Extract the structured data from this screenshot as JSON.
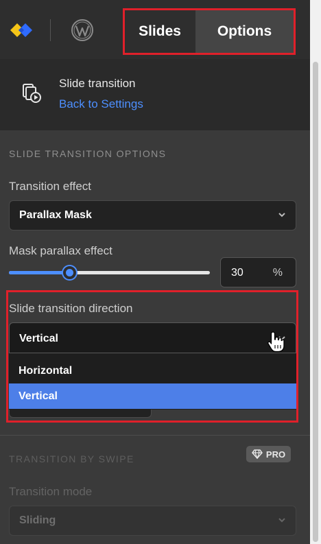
{
  "topbar": {
    "tabs": [
      "Slides",
      "Options"
    ]
  },
  "header": {
    "title": "Slide transition",
    "back_link": "Back to Settings"
  },
  "options": {
    "section_title": "SLIDE TRANSITION OPTIONS",
    "transition_effect_label": "Transition effect",
    "transition_effect_value": "Parallax Mask",
    "mask_parallax_label": "Mask parallax effect",
    "mask_parallax_value": "30",
    "mask_parallax_unit": "%",
    "mask_parallax_fraction": 0.3,
    "direction_label": "Slide transition direction",
    "direction_value": "Vertical",
    "direction_options": [
      "Horizontal",
      "Vertical"
    ]
  },
  "swipe": {
    "section_title": "TRANSITION BY SWIPE",
    "pro_badge": "PRO",
    "mode_label": "Transition mode",
    "mode_value": "Sliding"
  },
  "colors": {
    "accent": "#4d8fff",
    "highlight": "#e0202a",
    "selected_option": "#4d7fe8"
  },
  "icons": [
    "app-logo-icon",
    "wordpress-icon",
    "slide-transition-icon",
    "chevron-down-icon",
    "hand-pointer-icon",
    "diamond-icon"
  ]
}
